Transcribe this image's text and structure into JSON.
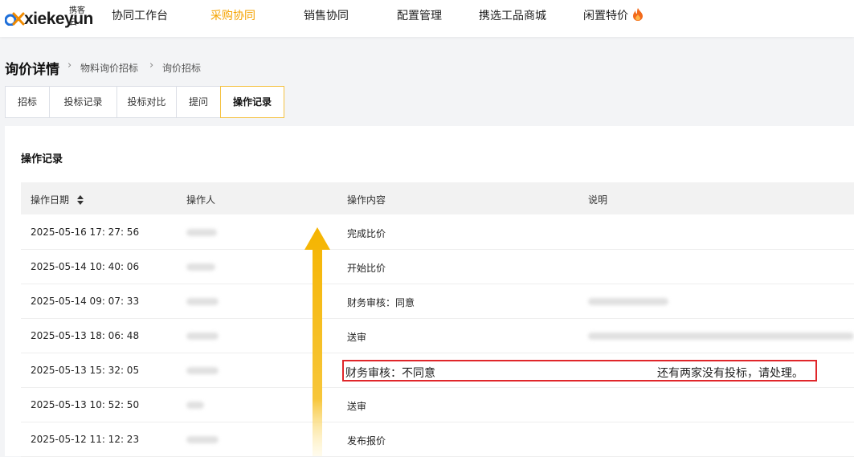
{
  "brand": {
    "name": "xiekeyun",
    "sub": "携客云"
  },
  "nav": [
    {
      "label": "协同工作台",
      "active": false
    },
    {
      "label": "采购协同",
      "active": true
    },
    {
      "label": "销售协同",
      "active": false
    },
    {
      "label": "配置管理",
      "active": false
    },
    {
      "label": "携选工品商城",
      "active": false
    },
    {
      "label": "闲置特价",
      "active": false
    }
  ],
  "colors": {
    "accent": "#f5a300",
    "highlight": "#e0262a",
    "arrow": "#f5b400"
  },
  "page": {
    "title": "询价详情",
    "breadcrumbs": [
      "物料询价招标",
      "询价招标"
    ]
  },
  "tabs": [
    {
      "label": "招标",
      "active": false
    },
    {
      "label": "投标记录",
      "active": false
    },
    {
      "label": "投标对比",
      "active": false
    },
    {
      "label": "提问",
      "active": false
    },
    {
      "label": "操作记录",
      "active": true
    }
  ],
  "section": {
    "title": "操作记录",
    "columns": [
      "操作日期",
      "操作人",
      "操作内容",
      "说明"
    ],
    "rows": [
      {
        "date": "2025-05-16 17: 27: 56",
        "content": "完成比价",
        "note": ""
      },
      {
        "date": "2025-05-14 10: 40: 06",
        "content": "开始比价",
        "note": ""
      },
      {
        "date": "2025-05-14 09: 07: 33",
        "content": "财务审核：同意",
        "note": ""
      },
      {
        "date": "2025-05-13 18: 06: 48",
        "content": "送审",
        "note": ""
      },
      {
        "date": "2025-05-13 15: 32: 05",
        "content": "",
        "note": ""
      },
      {
        "date": "2025-05-13 10: 52: 50",
        "content": "送审",
        "note": ""
      },
      {
        "date": "2025-05-12 11: 12: 23",
        "content": "发布报价",
        "note": ""
      }
    ]
  },
  "highlight": {
    "content": "财务审核：不同意",
    "note": "还有两家没有投标，请处理。"
  }
}
